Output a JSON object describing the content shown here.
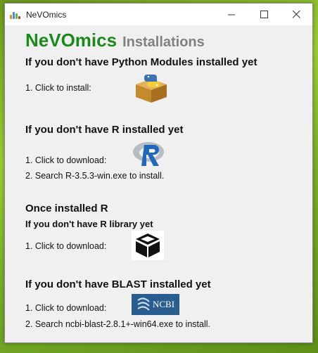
{
  "window": {
    "title": "NeVOmics",
    "controls": {
      "minimize": "—",
      "maximize": "☐",
      "close": "✕"
    }
  },
  "header": {
    "brand": "NeVOmics",
    "subtitle": "Installations"
  },
  "sections": {
    "python": {
      "heading": "If you don't have Python Modules installed yet",
      "step1": "1. Click to install:",
      "icon": "python-package-icon"
    },
    "r": {
      "heading": "If you don't have R installed yet",
      "step1": "1. Click to download:",
      "step2": "2. Search R-3.5.3-win.exe to install.",
      "icon": "r-logo-icon"
    },
    "r_library": {
      "heading": "Once installed R",
      "subheading": "If you don't have R library yet",
      "step1": "1. Click to download:",
      "icon": "package-box-icon"
    },
    "blast": {
      "heading": "If you don't have BLAST installed yet",
      "step1": "1. Click to download:",
      "step2": "2. Search ncbi-blast-2.8.1+-win64.exe to install.",
      "icon_label": "NCBI",
      "icon": "ncbi-logo-icon"
    }
  },
  "colors": {
    "brand": "#1b8a1b",
    "subtitle": "#808080",
    "ncbi_blue": "#2a5d8f"
  }
}
